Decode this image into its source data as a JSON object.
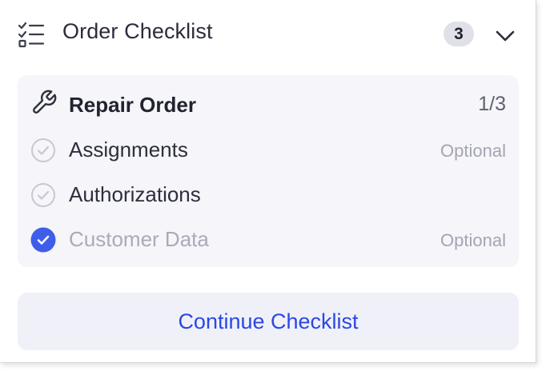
{
  "header": {
    "title": "Order Checklist",
    "count": "3",
    "icons": {
      "list": "checklist-icon",
      "toggle": "chevron-down-icon"
    }
  },
  "section": {
    "icon": "wrench-icon",
    "title": "Repair Order",
    "progress": "1/3",
    "items": [
      {
        "label": "Assignments",
        "meta": "Optional",
        "completed": false
      },
      {
        "label": "Authorizations",
        "meta": "",
        "completed": false
      },
      {
        "label": "Customer Data",
        "meta": "Optional",
        "completed": true
      }
    ]
  },
  "actions": {
    "continue_label": "Continue Checklist"
  },
  "colors": {
    "accent": "#3f5de8",
    "link": "#2a48e4",
    "section_bg": "#f5f5fa",
    "badge_bg": "#dfe0e8",
    "muted": "#a3a5b1"
  }
}
